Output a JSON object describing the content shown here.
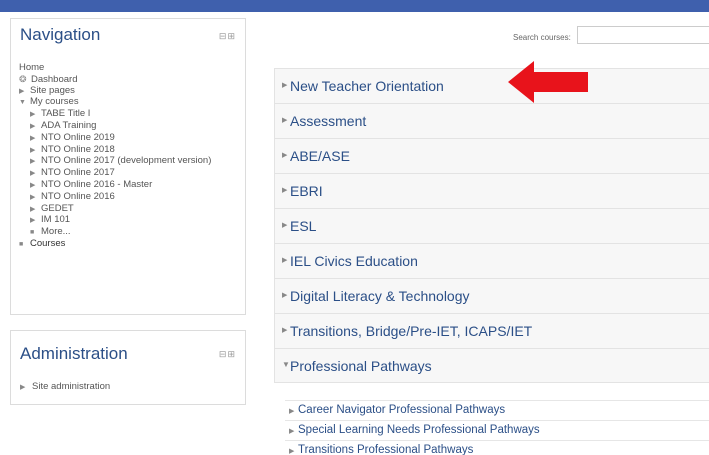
{
  "navigation": {
    "title": "Navigation",
    "controls": "⊟⊞",
    "home": "Home",
    "dashboard": "Dashboard",
    "site_pages": "Site pages",
    "my_courses": "My courses",
    "courses_list": [
      "TABE Title I",
      "ADA Training",
      "NTO Online 2019",
      "NTO Online 2018",
      "NTO Online 2017 (development version)",
      "NTO Online 2017",
      "NTO Online 2016 - Master",
      "NTO Online 2016",
      "GEDET",
      "IM 101"
    ],
    "more": "More...",
    "courses": "Courses"
  },
  "administration": {
    "title": "Administration",
    "controls": "⊟⊞",
    "site_administration": "Site administration"
  },
  "search": {
    "label": "Search courses:",
    "value": ""
  },
  "categories": [
    {
      "label": "New Teacher Orientation",
      "expanded": false
    },
    {
      "label": "Assessment",
      "expanded": false
    },
    {
      "label": "ABE/ASE",
      "expanded": false
    },
    {
      "label": "EBRI",
      "expanded": false
    },
    {
      "label": "ESL",
      "expanded": false
    },
    {
      "label": "IEL Civics Education",
      "expanded": false
    },
    {
      "label": "Digital Literacy & Technology",
      "expanded": false
    },
    {
      "label": "Transitions, Bridge/Pre-IET, ICAPS/IET",
      "expanded": false
    },
    {
      "label": "Professional Pathways",
      "expanded": true
    }
  ],
  "subcategories": [
    "Career Navigator Professional Pathways",
    "Special Learning Needs Professional Pathways",
    "Transitions Professional Pathways"
  ],
  "colors": {
    "topbar": "#3f60ad",
    "link": "#2b4f87",
    "annotation_arrow": "#e8131b"
  }
}
